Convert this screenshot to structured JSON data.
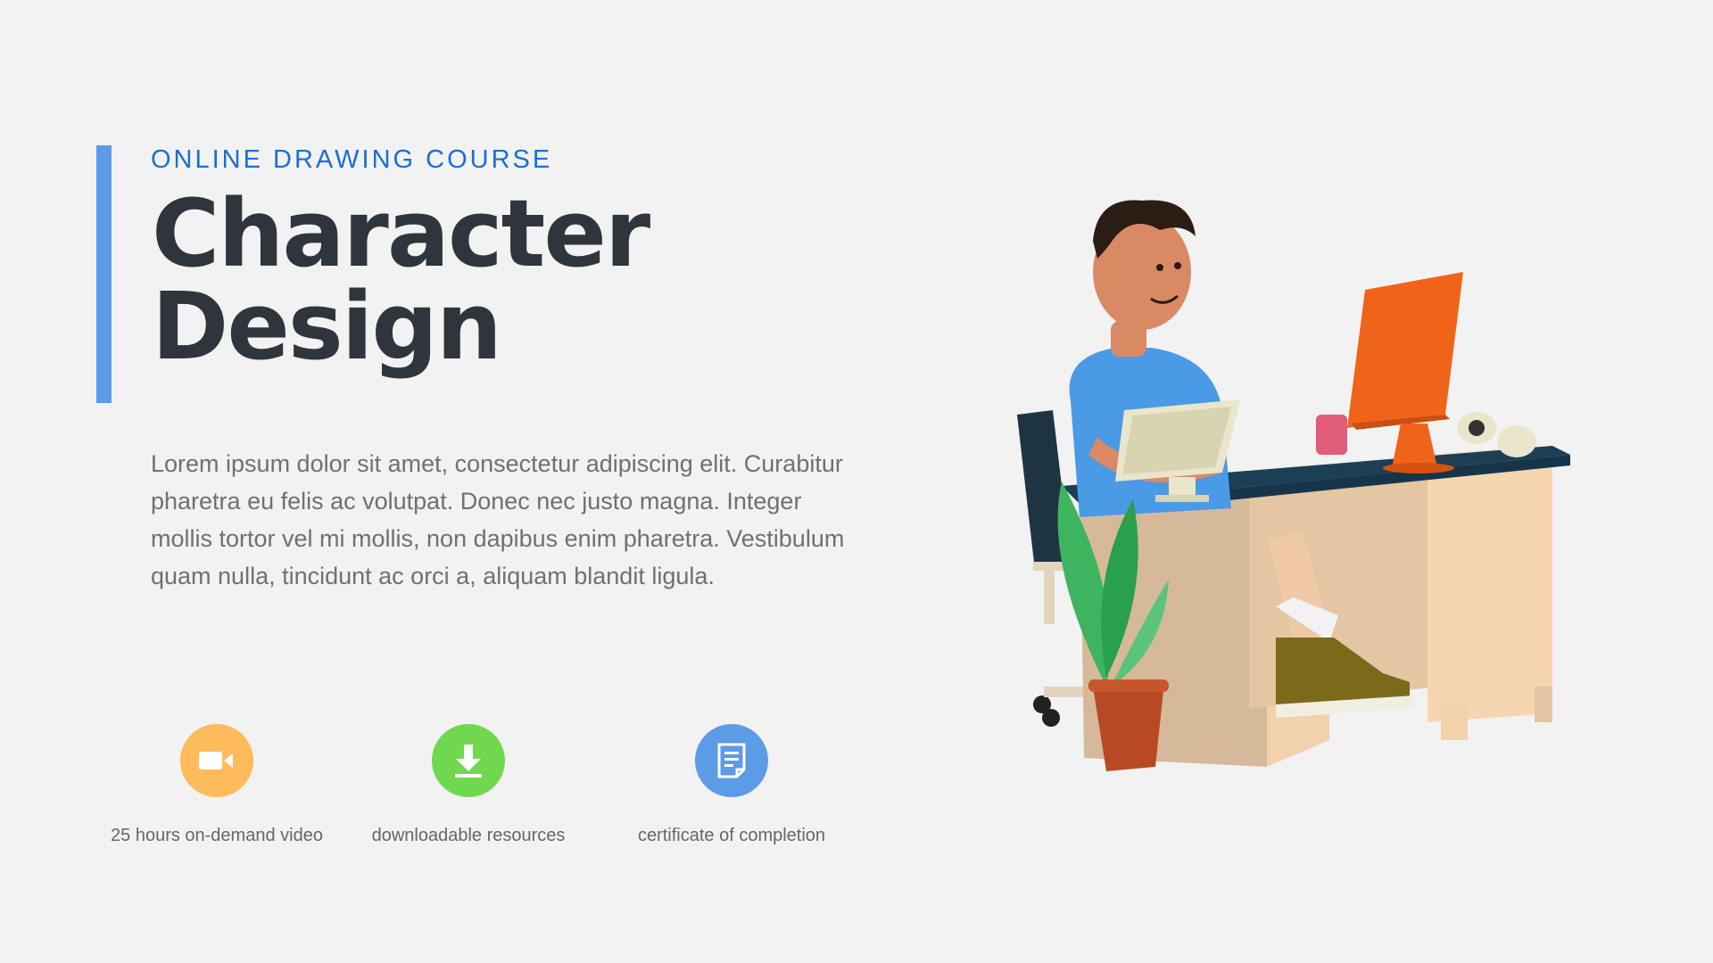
{
  "hero": {
    "eyebrow": "ONLINE DRAWING COURSE",
    "title_line1": "Character",
    "title_line2": "Design",
    "description": " Lorem ipsum dolor sit amet, consectetur adipiscing elit. Curabitur pharetra eu felis ac volutpat. Donec nec justo magna. Integer mollis tortor vel mi mollis, non dapibus enim pharetra. Vestibulum quam nulla, tincidunt ac orci a, aliquam blandit ligula."
  },
  "features": [
    {
      "label": "25 hours on-demand video",
      "icon": "video-camera-icon",
      "color": "#fdbb5c"
    },
    {
      "label": "downloadable resources",
      "icon": "download-icon",
      "color": "#6fd84f"
    },
    {
      "label": "certificate of completion",
      "icon": "document-icon",
      "color": "#5c9be5"
    }
  ],
  "colors": {
    "background": "#f2f2f2",
    "accent": "#5c9be5",
    "eyebrow": "#1a6fd0",
    "title": "#2e353c",
    "body": "#707070"
  }
}
